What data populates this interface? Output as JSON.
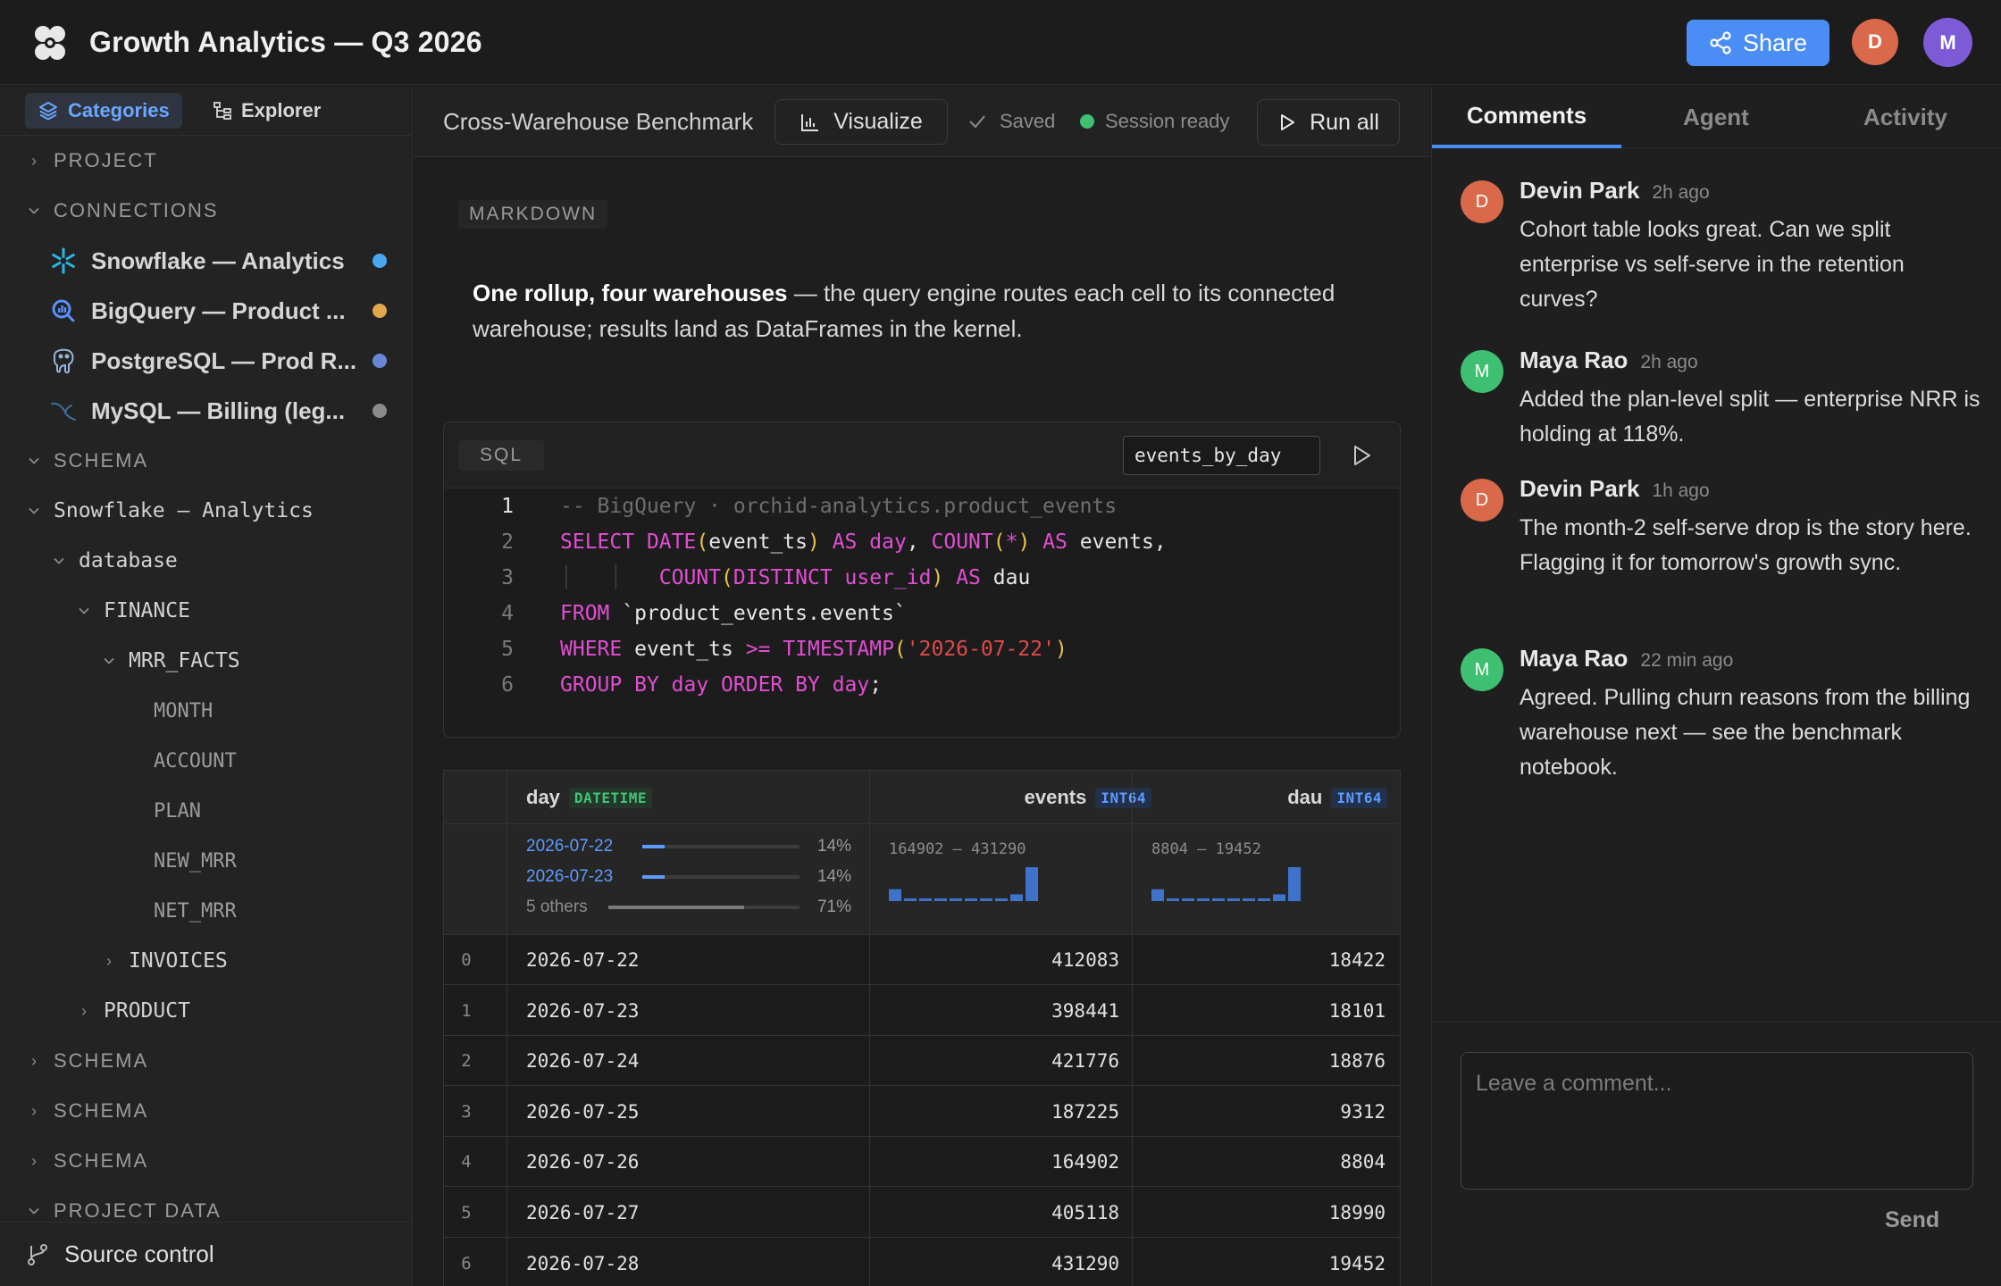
{
  "app": {
    "title": "Growth Analytics — Q3 2026"
  },
  "header": {
    "share_label": "Share",
    "avatars": [
      "D",
      "M"
    ]
  },
  "sidebar": {
    "tabs": [
      {
        "label": "Categories",
        "active": true
      },
      {
        "label": "Explorer",
        "active": false
      }
    ],
    "sections": {
      "project": "PROJECT",
      "connections": "CONNECTIONS",
      "schema": "SCHEMA",
      "project_data": "PROJECT DATA"
    },
    "connections": [
      {
        "label": "Snowflake — Analytics",
        "icon": "snowflake-icon",
        "status_color": "#4aa8f0"
      },
      {
        "label": "BigQuery — Product ...",
        "icon": "bigquery-icon",
        "status_color": "#e0a84a"
      },
      {
        "label": "PostgreSQL — Prod R...",
        "icon": "postgresql-icon",
        "status_color": "#6a86d6"
      },
      {
        "label": "MySQL — Billing (leg...",
        "icon": "mysql-icon",
        "status_color": "#8a8a8a"
      }
    ],
    "schema_tree": {
      "connection": "Snowflake — Analytics",
      "database": "database",
      "schema_finance": "FINANCE",
      "table_mrr": "MRR_FACTS",
      "columns": [
        "MONTH",
        "ACCOUNT",
        "PLAN",
        "NEW_MRR",
        "NET_MRR"
      ],
      "table_invoices": "INVOICES",
      "schema_product": "PRODUCT"
    },
    "source_control": "Source control"
  },
  "notebook": {
    "title": "Cross-Warehouse Benchmark",
    "visualize_label": "Visualize",
    "saved_label": "Saved",
    "session_label": "Session ready",
    "run_all_label": "Run all",
    "markdown": {
      "badge": "MARKDOWN",
      "bold": "One rollup, four warehouses",
      "rest": " — the query engine routes each cell to its connected warehouse; results land as DataFrames in the kernel."
    },
    "sql_cell": {
      "badge": "SQL",
      "variable": "events_by_day",
      "line_numbers": [
        "1",
        "2",
        "3",
        "4",
        "5",
        "6"
      ],
      "code": [
        "-- BigQuery · orchid-analytics.product_events",
        "SELECT DATE(event_ts) AS day, COUNT(*) AS events,",
        "       COUNT(DISTINCT user_id) AS dau",
        "FROM `product_events.events`",
        "WHERE event_ts >= TIMESTAMP('2026-07-22')",
        "GROUP BY day ORDER BY day;"
      ]
    },
    "result": {
      "columns": [
        {
          "name": "day",
          "type": "DATETIME"
        },
        {
          "name": "events",
          "type": "INT64"
        },
        {
          "name": "dau",
          "type": "INT64"
        }
      ],
      "summary": {
        "day": [
          {
            "label": "2026-07-22",
            "pct": "14%",
            "fraction": 0.14
          },
          {
            "label": "2026-07-23",
            "pct": "14%",
            "fraction": 0.14
          },
          {
            "label": "5 others",
            "pct": "71%",
            "fraction": 0.71
          }
        ],
        "events_range": "164902 — 431290",
        "dau_range": "8804 — 19452",
        "events_hist": [
          0.35,
          0.08,
          0.08,
          0.08,
          0.08,
          0.08,
          0.08,
          0.08,
          0.2,
          1.0
        ],
        "dau_hist": [
          0.35,
          0.08,
          0.08,
          0.08,
          0.08,
          0.08,
          0.08,
          0.08,
          0.2,
          1.0
        ]
      },
      "rows": [
        {
          "idx": "0",
          "day": "2026-07-22",
          "events": "412083",
          "dau": "18422"
        },
        {
          "idx": "1",
          "day": "2026-07-23",
          "events": "398441",
          "dau": "18101"
        },
        {
          "idx": "2",
          "day": "2026-07-24",
          "events": "421776",
          "dau": "18876"
        },
        {
          "idx": "3",
          "day": "2026-07-25",
          "events": "187225",
          "dau": "9312"
        },
        {
          "idx": "4",
          "day": "2026-07-26",
          "events": "164902",
          "dau": "8804"
        },
        {
          "idx": "5",
          "day": "2026-07-27",
          "events": "405118",
          "dau": "18990"
        },
        {
          "idx": "6",
          "day": "2026-07-28",
          "events": "431290",
          "dau": "19452"
        }
      ]
    }
  },
  "right_panel": {
    "tabs": [
      {
        "label": "Comments",
        "active": true
      },
      {
        "label": "Agent",
        "active": false
      },
      {
        "label": "Activity",
        "active": false
      }
    ],
    "comments": [
      {
        "initial": "D",
        "name": "Devin Park",
        "time": "2h ago",
        "color": "#d9694a",
        "text": "Cohort table looks great. Can we split enterprise vs self-serve in the retention curves?"
      },
      {
        "initial": "M",
        "name": "Maya Rao",
        "time": "2h ago",
        "color": "#3fbf72",
        "text": "Added the plan-level split — enterprise NRR is holding at 118%."
      },
      {
        "initial": "D",
        "name": "Devin Park",
        "time": "1h ago",
        "color": "#d9694a",
        "text": "The month-2 self-serve drop is the story here. Flagging it for tomorrow's growth sync."
      },
      {
        "initial": "M",
        "name": "Maya Rao",
        "time": "22 min ago",
        "color": "#3fbf72",
        "text": "Agreed. Pulling churn reasons from the billing warehouse next — see the benchmark notebook."
      }
    ],
    "comment_placeholder": "Leave a comment...",
    "send_label": "Send"
  },
  "colors": {
    "accent": "#4a8ef5",
    "keyword": "#e14ed2",
    "string": "#e24a4a",
    "paren": "#e8c547"
  }
}
